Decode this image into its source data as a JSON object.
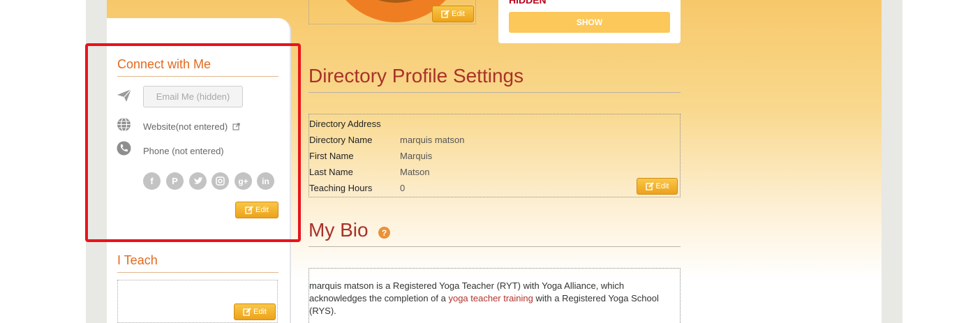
{
  "profile_image": {
    "edit_label": "Edit"
  },
  "visibility_card": {
    "status": "HIDDEN",
    "show_label": "SHOW"
  },
  "sidebar": {
    "connect": {
      "title": "Connect with Me",
      "email_button": "Email Me (hidden)",
      "website": "Website(not entered)",
      "phone": "Phone (not entered)",
      "social_icons": [
        "facebook-icon",
        "pinterest-icon",
        "twitter-icon",
        "instagram-icon",
        "google-plus-icon",
        "linkedin-icon"
      ],
      "edit_label": "Edit"
    },
    "teach": {
      "title": "I Teach",
      "edit_label": "Edit"
    }
  },
  "directory": {
    "title": "Directory Profile Settings",
    "rows": [
      {
        "label": "Directory Address",
        "value": ""
      },
      {
        "label": "Directory Name",
        "value": "marquis matson"
      },
      {
        "label": "First Name",
        "value": "Marquis"
      },
      {
        "label": "Last Name",
        "value": "Matson"
      },
      {
        "label": "Teaching Hours",
        "value": "0"
      }
    ],
    "edit_label": "Edit"
  },
  "bio": {
    "title": "My Bio",
    "help_icon": "?",
    "text_before": "marquis matson is a Registered Yoga Teacher (RYT) with Yoga Alliance, which acknowledges the completion of a ",
    "link_text": "yoga teacher training",
    "text_after": " with a Registered Yoga School (RYS)."
  },
  "colors": {
    "accent_orange": "#e36a1d",
    "title_red": "#a8322a",
    "edit_gold": "#f5b82e",
    "hidden_red": "#b8001b"
  }
}
